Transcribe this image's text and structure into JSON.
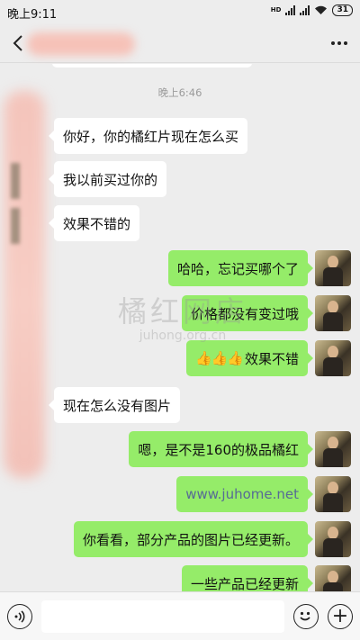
{
  "status_bar": {
    "time": "晚上9:11",
    "network_label": "HD",
    "battery": "31"
  },
  "chat": {
    "contact_name": "",
    "timestamp": "晚上6:46",
    "messages": [
      {
        "side": "left",
        "text": "你好，你的橘红片现在怎么买"
      },
      {
        "side": "left",
        "text": "我以前买过你的"
      },
      {
        "side": "left",
        "text": "效果不错的"
      },
      {
        "side": "right",
        "text": "哈哈，忘记买哪个了"
      },
      {
        "side": "right",
        "text": "价格都没有变过哦"
      },
      {
        "side": "right",
        "text": "效果不错",
        "emoji": "👍👍👍"
      },
      {
        "side": "left",
        "text": "现在怎么没有图片"
      },
      {
        "side": "right",
        "text": "嗯，是不是160的极品橘红"
      },
      {
        "side": "right",
        "text": "www.juhome.net",
        "link": true
      },
      {
        "side": "right",
        "text": "你看看，部分产品的图片已经更新。"
      },
      {
        "side": "right",
        "text": "一些产品已经更新"
      }
    ]
  },
  "watermark": {
    "main": "橘红网店",
    "sub": "juhong.org.cn"
  },
  "input_bar": {
    "placeholder": ""
  },
  "colors": {
    "background": "#ededed",
    "bubble_self": "#95ec69",
    "bubble_other": "#ffffff",
    "link": "#576b95"
  },
  "icons": [
    "back-arrow-icon",
    "more-dots-icon",
    "voice-icon",
    "emoji-icon",
    "plus-icon",
    "wifi-icon",
    "signal-icon",
    "battery-icon"
  ]
}
